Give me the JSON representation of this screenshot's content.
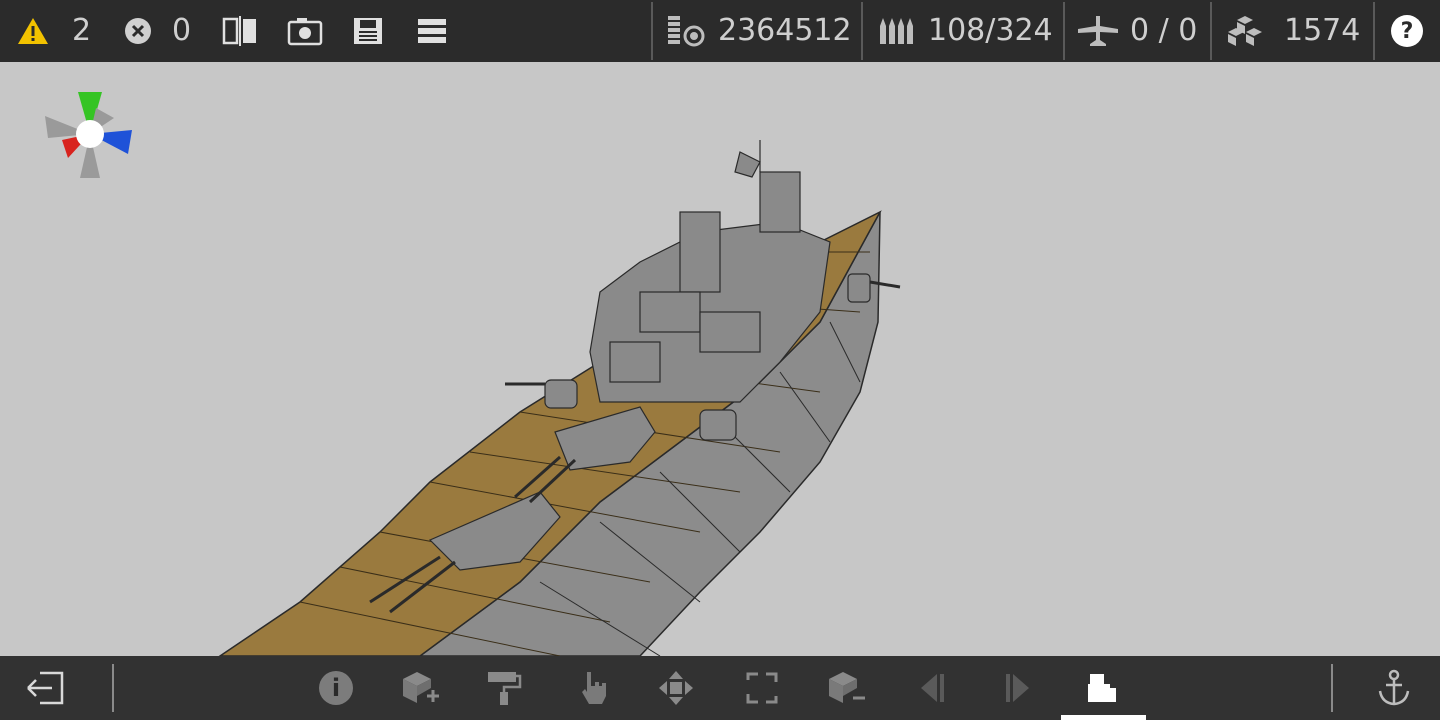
{
  "topbar": {
    "warnings_count": "2",
    "errors_count": "0",
    "cost": "2364512",
    "ammo": "108/324",
    "aircraft": "0 / 0",
    "parts": "1574",
    "help_label": "?"
  },
  "bottombar": {
    "info_label": "i"
  },
  "colors": {
    "warning": "#f2c200",
    "deck": "#9a7a3e",
    "hull": "#8c8c8c",
    "background": "#c7c7c7",
    "toolbar": "#2b2b2b",
    "axis_green": "#35c424",
    "axis_red": "#d8231e",
    "axis_blue": "#1f52d8"
  },
  "icons": [
    "warning-icon",
    "error-icon",
    "mirror-icon",
    "camera-icon",
    "save-icon",
    "menu-icon",
    "cost-icon",
    "ammo-icon",
    "aircraft-icon",
    "parts-icon",
    "help-icon",
    "exit-icon",
    "info-icon",
    "add-part-icon",
    "paint-icon",
    "select-icon",
    "move-icon",
    "rotate-icon",
    "remove-part-icon",
    "undo-icon",
    "redo-icon",
    "build-icon",
    "anchor-icon"
  ]
}
